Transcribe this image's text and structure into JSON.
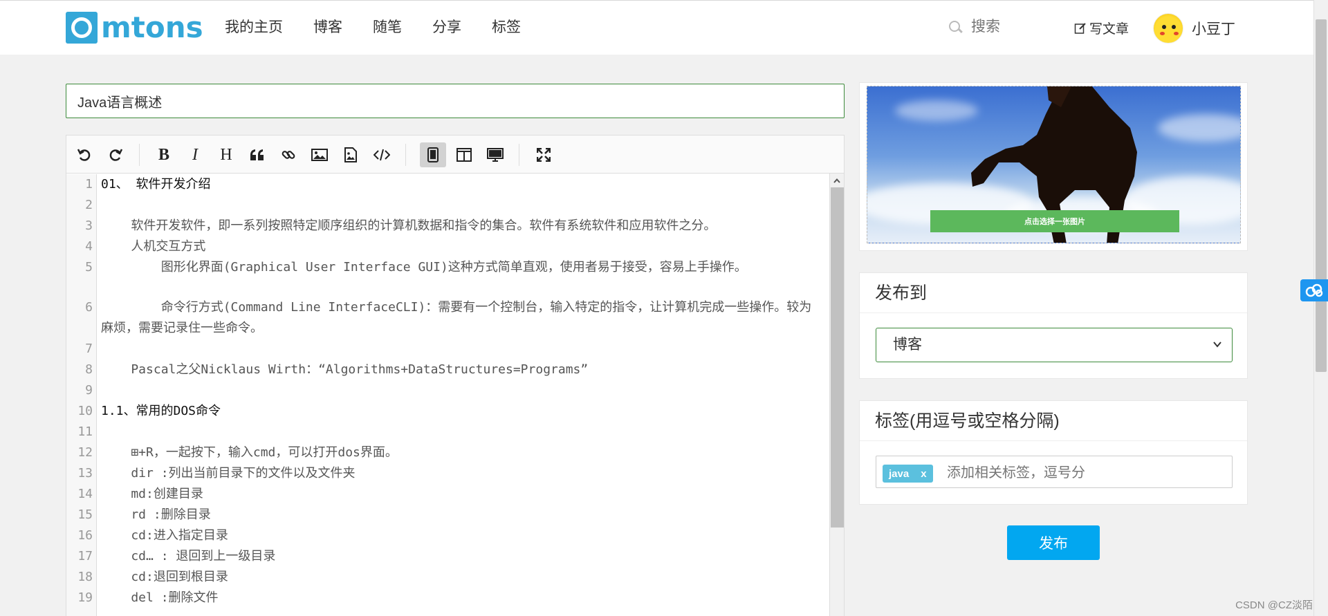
{
  "header": {
    "logo_text": "mtons",
    "nav": [
      "我的主页",
      "博客",
      "随笔",
      "分享",
      "标签"
    ],
    "search_placeholder": "搜索",
    "write_label": "写文章",
    "username": "小豆丁"
  },
  "editor": {
    "title_value": "Java语言概述",
    "toolbar_icons": [
      "undo-icon",
      "redo-icon",
      "bold-icon",
      "italic-icon",
      "heading-icon",
      "quote-icon",
      "link-icon",
      "image-icon",
      "upload-image-icon",
      "code-icon",
      "edit-mode-icon",
      "split-mode-icon",
      "preview-mode-icon",
      "fullscreen-icon"
    ],
    "lines": [
      {
        "n": "1",
        "text": "01、 软件开发介绍",
        "dark": true
      },
      {
        "n": "2",
        "text": ""
      },
      {
        "n": "3",
        "text": "    软件开发软件，即一系列按照特定顺序组织的计算机数据和指令的集合。软件有系统软件和应用软件之分。"
      },
      {
        "n": "4",
        "text": "    人机交互方式"
      },
      {
        "n": "5",
        "text": "        图形化界面(Graphical User Interface GUI)这种方式简单直观，使用者易于接受，容易上手操作。",
        "wrap": true
      },
      {
        "n": "6",
        "text": "        命令行方式(Command Line InterfaceCLI)：需要有一个控制台，输入特定的指令，让计算机完成一些操作。较为麻烦，需要记录住一些命令。",
        "wrap": true
      },
      {
        "n": "7",
        "text": ""
      },
      {
        "n": "8",
        "text": "    Pascal之父Nicklaus Wirth：“Algorithms+DataStructures=Programs”"
      },
      {
        "n": "9",
        "text": ""
      },
      {
        "n": "10",
        "text": "1.1、常用的DOS命令",
        "dark": true
      },
      {
        "n": "11",
        "text": ""
      },
      {
        "n": "12",
        "text": "    ⊞+R，一起按下，输入cmd，可以打开dos界面。"
      },
      {
        "n": "13",
        "text": "    dir :列出当前目录下的文件以及文件夹"
      },
      {
        "n": "14",
        "text": "    md:创建目录"
      },
      {
        "n": "15",
        "text": "    rd :删除目录"
      },
      {
        "n": "16",
        "text": "    cd:进入指定目录"
      },
      {
        "n": "17",
        "text": "    cd… : 退回到上一级目录"
      },
      {
        "n": "18",
        "text": "    cd:退回到根目录"
      },
      {
        "n": "19",
        "text": "    del :删除文件"
      }
    ]
  },
  "cover": {
    "button_label": "点击选择一张图片"
  },
  "publish_to": {
    "heading": "发布到",
    "selected": "博客"
  },
  "tags": {
    "heading": "标签(用逗号或空格分隔)",
    "chips": [
      {
        "label": "java",
        "remove": "x"
      }
    ],
    "input_placeholder": "添加相关标签，逗号分"
  },
  "publish_button": "发布",
  "watermark": "CSDN @CZ淡陌",
  "colors": {
    "brand": "#34a7d8",
    "accent_green": "#5cb85c",
    "publish_blue": "#02a7f0",
    "tag_blue": "#5bc0de"
  }
}
